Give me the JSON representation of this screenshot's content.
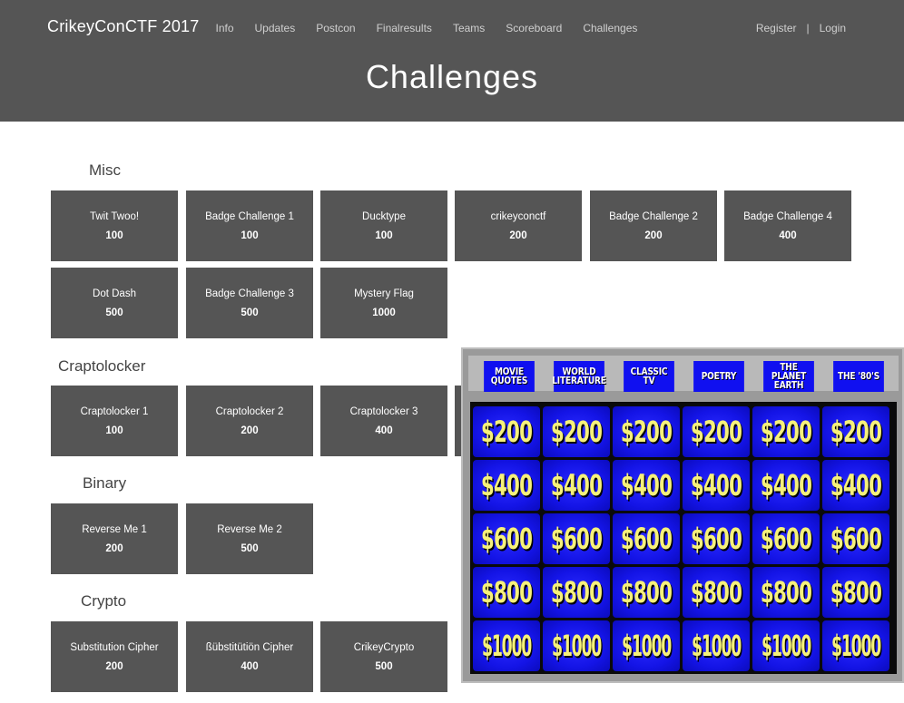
{
  "header": {
    "brand": "CrikeyConCTF 2017",
    "nav": [
      "Info",
      "Updates",
      "Postcon",
      "Finalresults",
      "Teams",
      "Scoreboard",
      "Challenges"
    ],
    "register": "Register",
    "separator": "|",
    "login": "Login",
    "title": "Challenges"
  },
  "categories": [
    {
      "name": "Misc",
      "challenges": [
        {
          "name": "Twit Twoo!",
          "points": "100"
        },
        {
          "name": "Badge Challenge 1",
          "points": "100"
        },
        {
          "name": "Ducktype",
          "points": "100"
        },
        {
          "name": "crikeyconctf",
          "points": "200"
        },
        {
          "name": "Badge Challenge 2",
          "points": "200"
        },
        {
          "name": "Badge Challenge 4",
          "points": "400"
        },
        {
          "name": "Dot Dash",
          "points": "500"
        },
        {
          "name": "Badge Challenge 3",
          "points": "500"
        },
        {
          "name": "Mystery Flag",
          "points": "1000"
        }
      ]
    },
    {
      "name": "Craptolocker",
      "challenges": [
        {
          "name": "Craptolocker 1",
          "points": "100"
        },
        {
          "name": "Craptolocker 2",
          "points": "200"
        },
        {
          "name": "Craptolocker 3",
          "points": "400"
        }
      ]
    },
    {
      "name": "Binary",
      "challenges": [
        {
          "name": "Reverse Me 1",
          "points": "200"
        },
        {
          "name": "Reverse Me 2",
          "points": "500"
        }
      ]
    },
    {
      "name": "Crypto",
      "challenges": [
        {
          "name": "Substitution Cipher",
          "points": "200"
        },
        {
          "name": "ßübstitütiön Cipher",
          "points": "400"
        },
        {
          "name": "CrikeyCrypto",
          "points": "500"
        }
      ]
    }
  ],
  "jeopardy": {
    "categories": [
      "MOVIE QUOTES",
      "WORLD LITERATURE",
      "CLASSIC TV",
      "POETRY",
      "THE PLANET EARTH",
      "THE '80'S"
    ],
    "values": [
      "$200",
      "$400",
      "$600",
      "$800",
      "$1000"
    ]
  },
  "colors": {
    "header_bg": "#555555",
    "tile_bg": "#555555",
    "board_blue": "#1414e6",
    "board_yellow": "#f6f17a"
  }
}
